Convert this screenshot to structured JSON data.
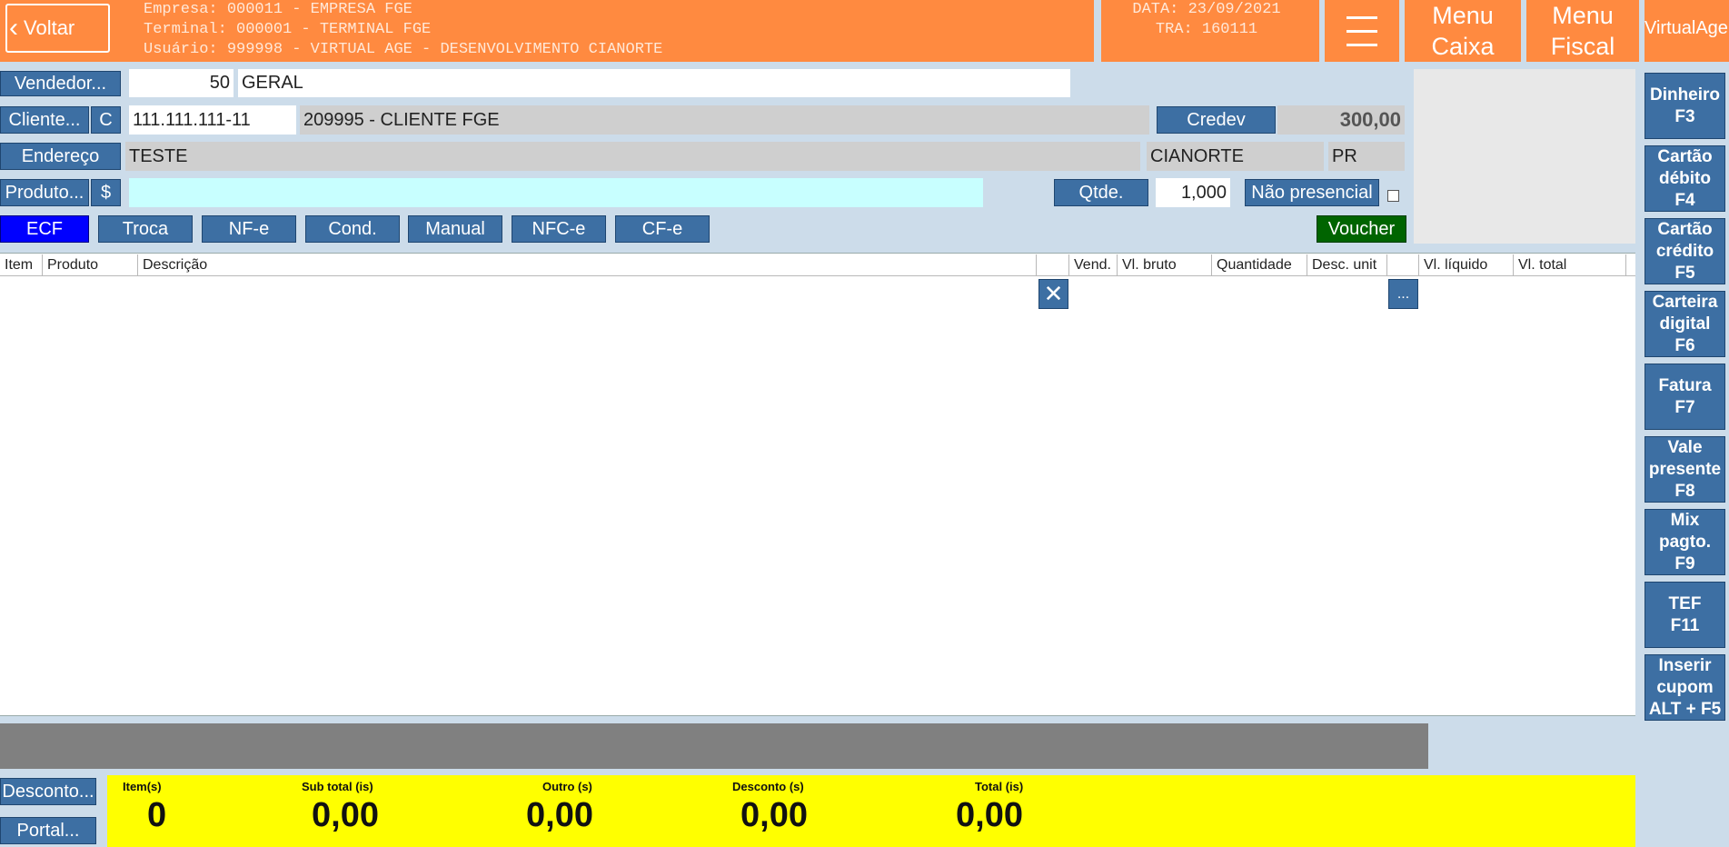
{
  "header": {
    "back_label": "Voltar",
    "company_line": "Empresa: 000011 - EMPRESA FGE",
    "terminal_line": "Terminal: 000001 - TERMINAL FGE",
    "user_line": "Usuário: 999998 - VIRTUAL AGE - DESENVOLVIMENTO CIANORTE",
    "date_line": "DATA: 23/09/2021",
    "tra_line": "TRA: 160111",
    "menu_caixa_1": "Menu",
    "menu_caixa_2": "Caixa",
    "menu_fiscal_1": "Menu",
    "menu_fiscal_2": "Fiscal",
    "brand": "VirtualAge"
  },
  "form": {
    "vendedor_label": "Vendedor...",
    "vendedor_code": "50",
    "vendedor_name": "GERAL",
    "cliente_label": "Cliente...",
    "cliente_c": "C",
    "cliente_doc": "111.111.111-11",
    "cliente_name": "209995 - CLIENTE FGE",
    "credev_label": "Credev",
    "credev_value": "300,00",
    "endereco_label": "Endereço",
    "endereco_value": "TESTE",
    "city": "CIANORTE",
    "state": "PR",
    "produto_label": "Produto...",
    "produto_dollar": "$",
    "produto_value": "",
    "qtde_label": "Qtde.",
    "qtde_value": "1,000",
    "nao_presencial_label": "Não presencial"
  },
  "modes": {
    "ecf": "ECF",
    "troca": "Troca",
    "nfe": "NF-e",
    "cond": "Cond.",
    "manual": "Manual",
    "nfce": "NFC-e",
    "cfe": "CF-e",
    "voucher": "Voucher"
  },
  "table": {
    "columns": [
      "Item",
      "Produto",
      "Descrição",
      "",
      "Vend.",
      "Vl. bruto",
      "Quantidade",
      "Desc. unit",
      "",
      "Vl. líquido",
      "Vl. total"
    ],
    "delete_icon": "close-icon",
    "more_label": "...",
    "rows": []
  },
  "payments": [
    "Dinheiro\nF3",
    "Cartão\ndébito\nF4",
    "Cartão\ncrédito\nF5",
    "Carteira\ndigital\nF6",
    "Fatura\nF7",
    "Vale\npresente\nF8",
    "Mix\npagto.\nF9",
    "TEF\nF11",
    "Inserir\ncupom\nALT + F5"
  ],
  "footer": {
    "desconto_label": "Desconto...",
    "portal_label": "Portal...",
    "items_label": "Item(s)",
    "items_value": "0",
    "subtotal_label": "Sub total (is)",
    "subtotal_value": "0,00",
    "outro_label": "Outro (s)",
    "outro_value": "0,00",
    "desconto_total_label": "Desconto (s)",
    "desconto_total_value": "0,00",
    "total_label": "Total (is)",
    "total_value": "0,00"
  },
  "colors": {
    "header": "#ff8a40",
    "button": "#3d6fa3",
    "ecf_active": "#0000ff",
    "voucher": "#006400",
    "totals_bar": "#ffff00",
    "product_field": "#c8ffff"
  }
}
